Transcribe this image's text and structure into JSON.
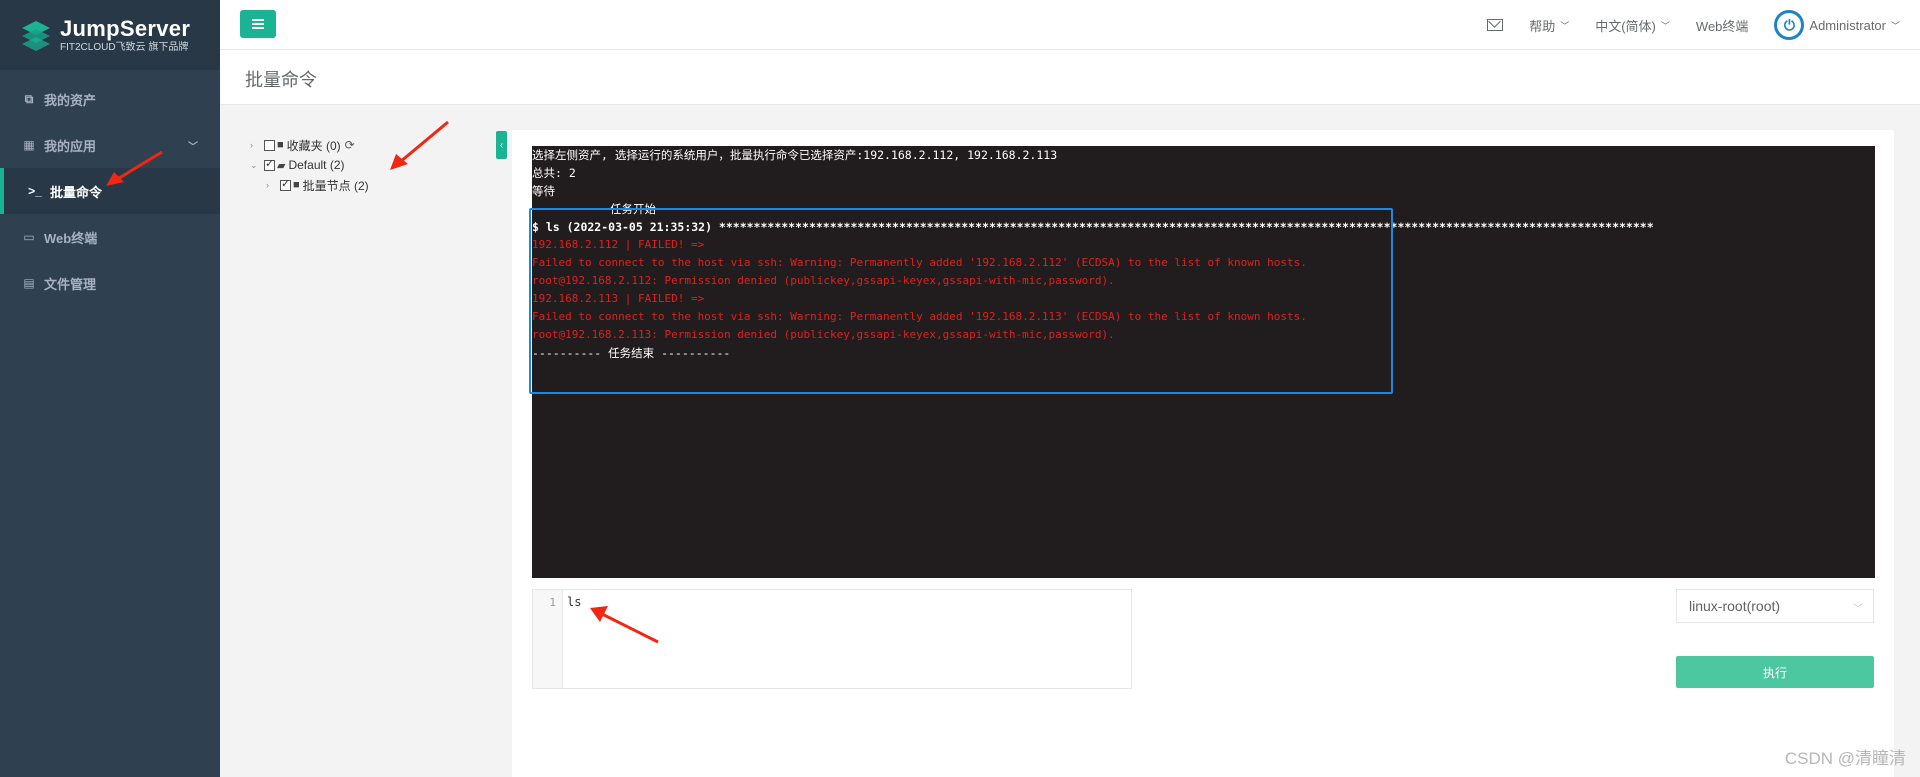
{
  "logo": {
    "title": "JumpServer",
    "subtitle": "FIT2CLOUD飞致云 旗下品牌"
  },
  "sidebar": {
    "items": [
      {
        "label": "我的资产",
        "icon": "assets-icon"
      },
      {
        "label": "我的应用",
        "icon": "grid-icon"
      },
      {
        "label": "批量命令",
        "icon": "terminal-prompt-icon"
      },
      {
        "label": "Web终端",
        "icon": "window-icon"
      },
      {
        "label": "文件管理",
        "icon": "file-icon"
      }
    ],
    "active": "批量命令"
  },
  "header": {
    "help": "帮助",
    "language": "中文(简体)",
    "web_terminal": "Web终端",
    "user": "Administrator"
  },
  "page": {
    "title": "批量命令"
  },
  "tree": {
    "favorites": "收藏夹 (0)",
    "default": "Default (2)",
    "batch_node": "批量节点 (2)"
  },
  "terminal": {
    "lines": [
      {
        "text": "选择左侧资产, 选择运行的系统用户，批量执行命令已选择资产:192.168.2.112, 192.168.2.113",
        "style": ""
      },
      {
        "text": "总共: 2",
        "style": ""
      },
      {
        "text": "等待",
        "style": ""
      },
      {
        "text": "任务开始",
        "style": "indent"
      },
      {
        "text": "$ ls (2022-03-05 21:35:32) ***************************************************************************************************************************************",
        "style": "bold"
      },
      {
        "text": "192.168.2.112 | FAILED! =>",
        "style": "red"
      },
      {
        "text": "Failed to connect to the host via ssh: Warning: Permanently added '192.168.2.112' (ECDSA) to the list of known hosts.",
        "style": "red"
      },
      {
        "text": "root@192.168.2.112: Permission denied (publickey,gssapi-keyex,gssapi-with-mic,password).",
        "style": "red"
      },
      {
        "text": "192.168.2.113 | FAILED! =>",
        "style": "red"
      },
      {
        "text": "Failed to connect to the host via ssh: Warning: Permanently added '192.168.2.113' (ECDSA) to the list of known hosts.",
        "style": "red"
      },
      {
        "text": "root@192.168.2.113: Permission denied (publickey,gssapi-keyex,gssapi-with-mic,password).",
        "style": "red"
      },
      {
        "text": "---------- 任务结束 ----------",
        "style": ""
      }
    ]
  },
  "editor": {
    "line_number": "1",
    "code": "ls"
  },
  "system_user_select": {
    "value": "linux-root(root)"
  },
  "execute_button": "执行",
  "watermark": "CSDN @清瞳清",
  "colors": {
    "sidebar": "#2f4050",
    "accent": "#1ab394",
    "terminal_bg": "#211c1d",
    "error": "#e0211f",
    "highlight": "#1e88e5",
    "arrow": "#f22613"
  }
}
